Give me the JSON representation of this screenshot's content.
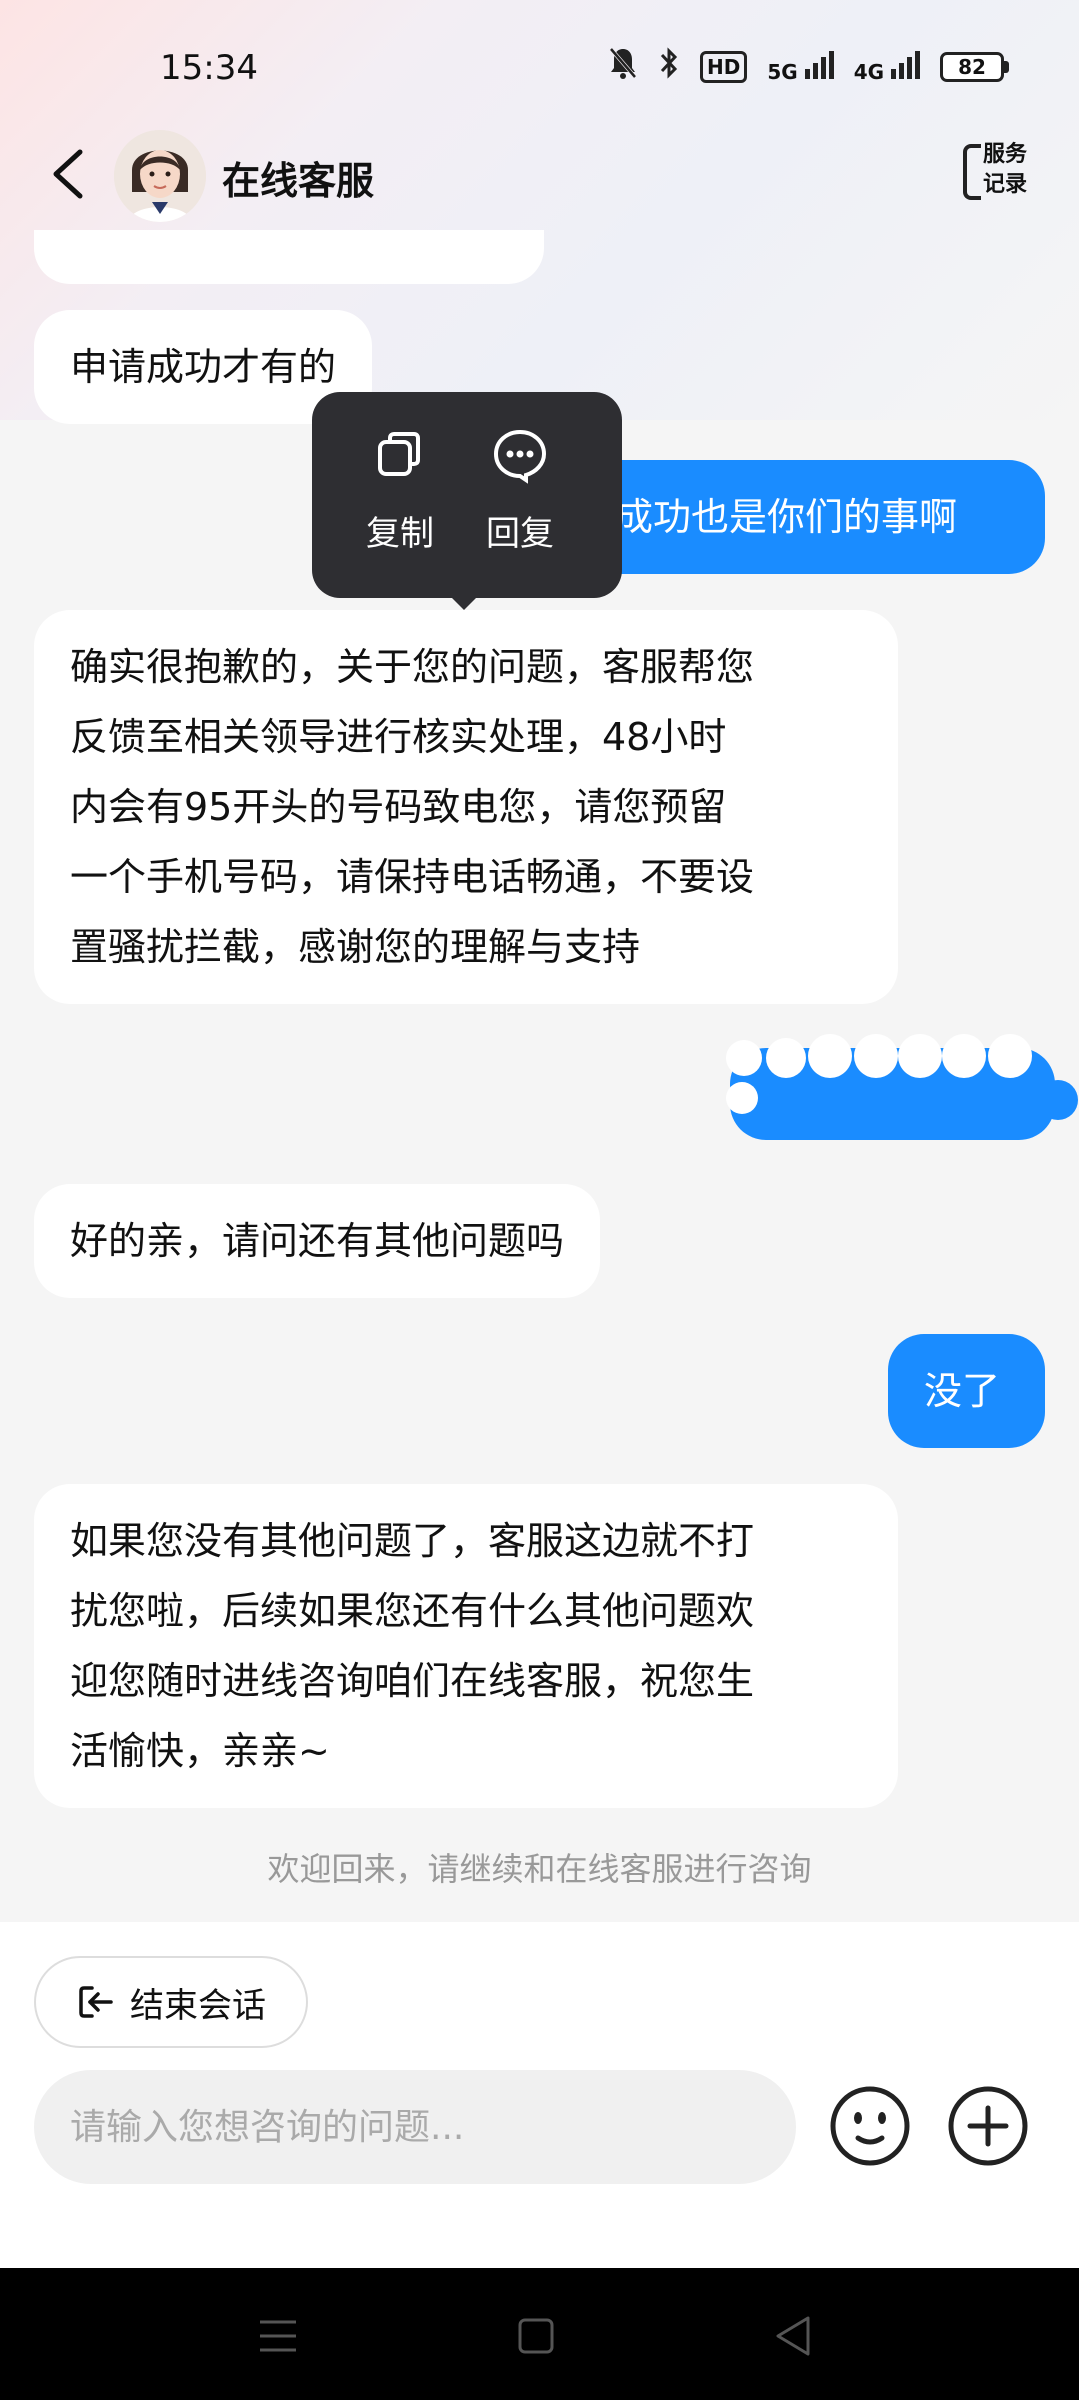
{
  "status_bar": {
    "time": "15:34",
    "hd": "HD",
    "net1": "5G",
    "net2": "4G",
    "battery": "82",
    "icons": [
      "mute-bell-icon",
      "bluetooth-icon",
      "hd-icon",
      "signal-5g-icon",
      "signal-4g-icon",
      "battery-icon"
    ]
  },
  "header": {
    "title": "在线客服",
    "record_label_line1": "服务",
    "record_label_line2": "记录"
  },
  "messages": [
    {
      "side": "left",
      "text": "申请成功才有的"
    },
    {
      "side": "right",
      "text": "成功也是你们的事啊"
    },
    {
      "side": "left",
      "lines": [
        "确实很抱歉的，关于您的问题，客服帮您",
        "反馈至相关领导进行核实处理，48小时",
        "内会有95开头的号码致电您，请您预留",
        "一个手机号码，请保持电话畅通，不要设",
        "置骚扰拦截，感谢您的理解与支持"
      ]
    },
    {
      "side": "left",
      "text": "好的亲，请问还有其他问题吗"
    },
    {
      "side": "right",
      "text": "没了"
    },
    {
      "side": "left",
      "lines": [
        "如果您没有其他问题了，客服这边就不打",
        "扰您啦，后续如果您还有什么其他问题欢",
        "迎您随时进线咨询咱们在线客服，祝您生",
        "活愉快，亲亲~"
      ]
    }
  ],
  "system_note": "欢迎回来，请继续和在线客服进行咨询",
  "popup": {
    "copy_label": "复制",
    "reply_label": "回复"
  },
  "bottom": {
    "end_session_label": "结束会话",
    "input_placeholder": "请输入您想咨询的问题..."
  },
  "colors": {
    "accent": "#1a8cff",
    "popup_bg": "#2e2e32",
    "chat_bg": "#f5f5f5"
  }
}
